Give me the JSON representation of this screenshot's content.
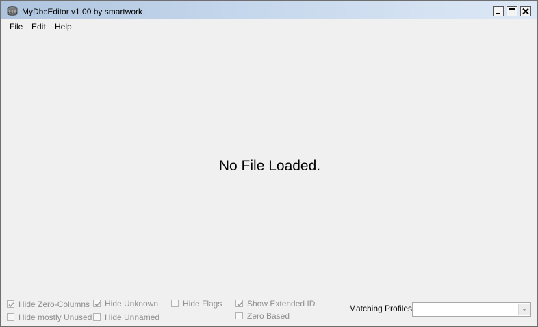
{
  "window": {
    "title": "MyDbcEditor v1.00 by smartwork"
  },
  "menu": {
    "items": [
      "File",
      "Edit",
      "Help"
    ]
  },
  "main": {
    "message": "No File Loaded."
  },
  "options": {
    "hide_zero_columns": {
      "label": "Hide Zero-Columns",
      "checked": true
    },
    "hide_mostly_unused": {
      "label": "Hide mostly Unused",
      "checked": false
    },
    "hide_unknown": {
      "label": "Hide Unknown",
      "checked": true
    },
    "hide_unnamed": {
      "label": "Hide Unnamed",
      "checked": false
    },
    "hide_flags": {
      "label": "Hide Flags",
      "checked": false
    },
    "show_extended_id": {
      "label": "Show Extended ID",
      "checked": true
    },
    "zero_based": {
      "label": "Zero Based",
      "checked": false
    }
  },
  "matching_profiles": {
    "label": "Matching Profiles:",
    "value": ""
  },
  "colors": {
    "titlebar": "#c5d7ec",
    "background": "#f0f0f0",
    "disabled_text": "#8f8f8f"
  }
}
